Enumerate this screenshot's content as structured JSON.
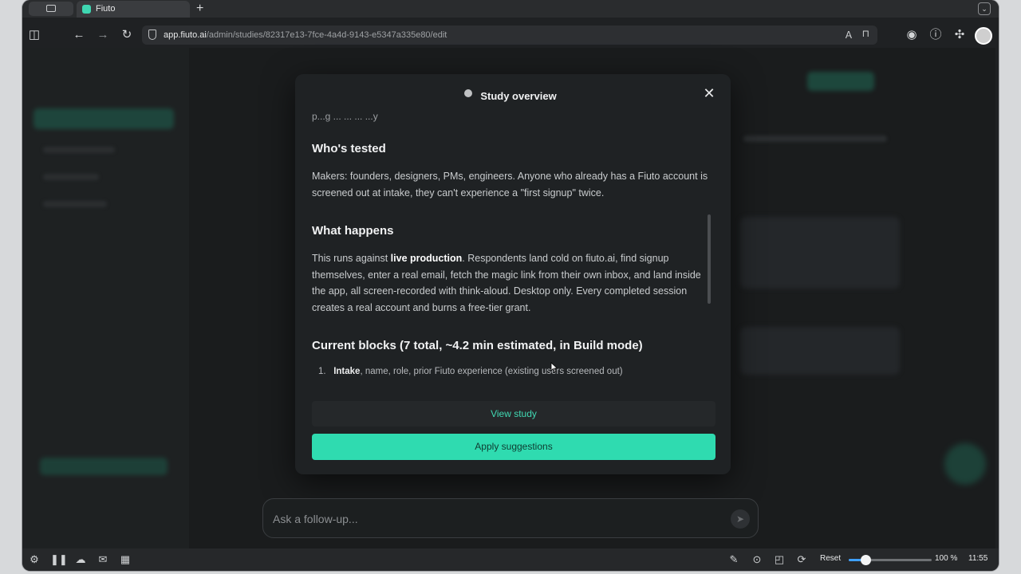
{
  "browser": {
    "tab_title": "Fiuto",
    "new_tab": "+",
    "url_host": "app.fiuto.ai",
    "url_path": "/admin/studies/82317e13-7fce-4a4d-9143-e5347a335e80/edit"
  },
  "modal": {
    "title": "Study overview",
    "close": "✕",
    "cut_line": "p...g ... ... ... ...y",
    "sections": [
      {
        "title": "Who's tested",
        "text": "Makers: founders, designers, PMs, engineers. Anyone who already has a Fiuto account is screened out at intake, they can't experience a \"first signup\" twice."
      },
      {
        "title": "What happens",
        "bold": "live production",
        "text_before": "This runs against ",
        "text_after": ". Respondents land cold on fiuto.ai, find signup themselves, enter a real email, fetch the magic link from their own inbox, and land inside the app, all screen-recorded with think-aloud. Desktop only. Every completed session creates a real account and burns a free-tier grant."
      },
      {
        "title": "Current blocks (7 total, ~4.2 min estimated, in Build mode)"
      }
    ],
    "list_first": {
      "num": "1.",
      "label": "Intake",
      "text": ", name, role, prior Fiuto experience (existing users screened out)"
    },
    "view_study": "View study",
    "apply_suggestions": "Apply suggestions"
  },
  "followup": {
    "placeholder": "Ask a follow-up..."
  },
  "statusbar": {
    "reset": "Reset",
    "zoom": "100 %",
    "zoom_level": 0.2,
    "time": "11:55"
  }
}
